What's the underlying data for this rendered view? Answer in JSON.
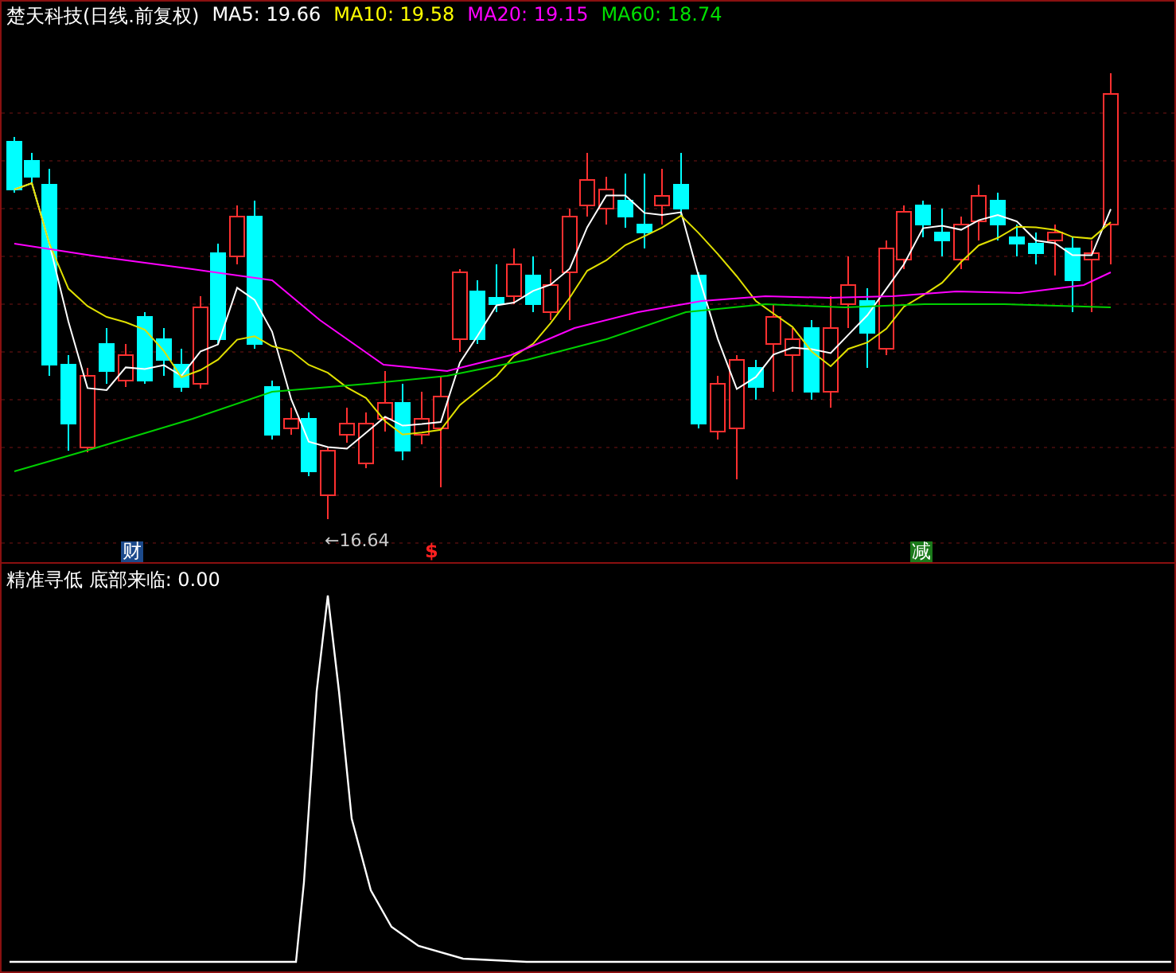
{
  "chart_title": "楚天科技(日线.前复权)",
  "ma_legend": [
    {
      "label": "MA5: 19.66",
      "color": "#ffffff"
    },
    {
      "label": "MA10: 19.58",
      "color": "#ffff00"
    },
    {
      "label": "MA20: 19.15",
      "color": "#ff00ff"
    },
    {
      "label": "MA60: 18.74",
      "color": "#00e000"
    }
  ],
  "low_marker": "←16.64",
  "signals": [
    {
      "text": "财",
      "kind": "badge",
      "color": "#1c4a8c"
    },
    {
      "text": "$",
      "kind": "plain",
      "color": "#ff2020"
    },
    {
      "text": "减",
      "kind": "badge",
      "color": "#1a7a1a"
    }
  ],
  "indicator_legend": "精准寻低 底部来临: 0.00"
}
